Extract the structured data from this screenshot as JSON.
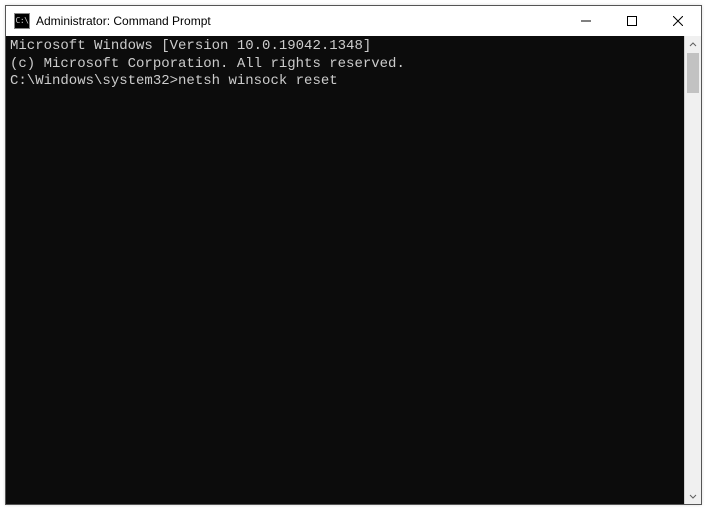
{
  "window": {
    "title": "Administrator: Command Prompt",
    "icon_text": "C:\\"
  },
  "terminal": {
    "line1": "Microsoft Windows [Version 10.0.19042.1348]",
    "line2": "(c) Microsoft Corporation. All rights reserved.",
    "blank": "",
    "prompt": "C:\\Windows\\system32>",
    "command": "netsh winsock reset"
  }
}
